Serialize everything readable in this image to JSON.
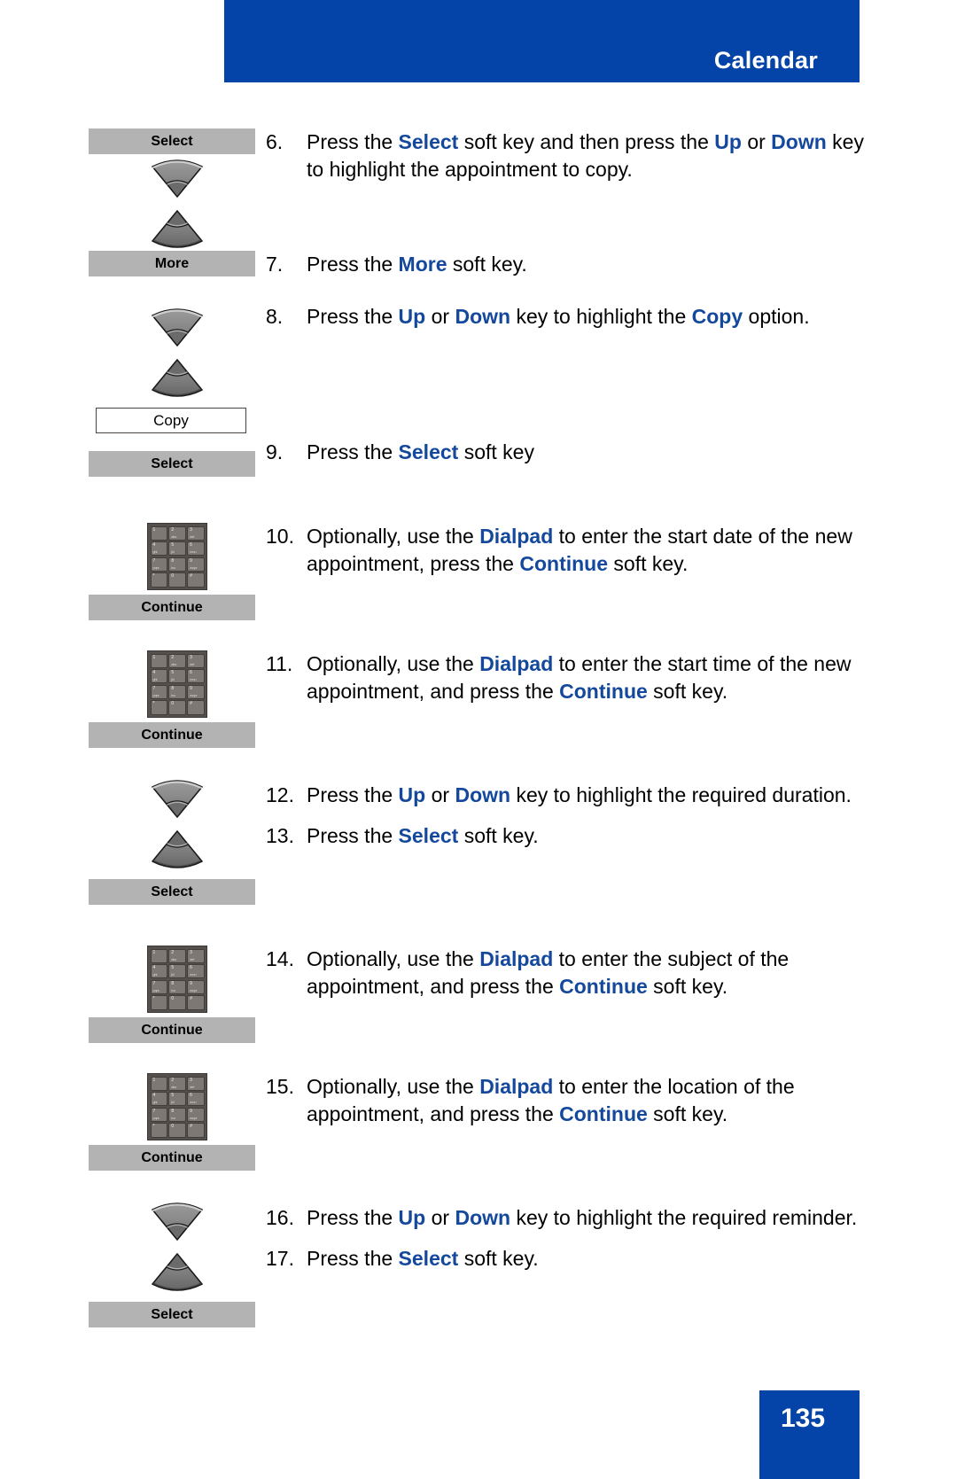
{
  "header": {
    "title": "Calendar",
    "bar_color": "#0443a7"
  },
  "footer": {
    "page_number": "135",
    "bar_color": "#0443a7"
  },
  "theme": {
    "keyword_color": "#13489c",
    "softkey_bg": "#b3b3b3",
    "menu_box_border": "#4a4440",
    "dialpad_body": "#56504c",
    "dialpad_key": "#7d7873"
  },
  "dialpad_keys": [
    {
      "digit": "1",
      "letters": ""
    },
    {
      "digit": "2",
      "letters": "abc"
    },
    {
      "digit": "3",
      "letters": "def"
    },
    {
      "digit": "4",
      "letters": "ghi"
    },
    {
      "digit": "5",
      "letters": "jkl"
    },
    {
      "digit": "6",
      "letters": "mno"
    },
    {
      "digit": "7",
      "letters": "pqrs"
    },
    {
      "digit": "8",
      "letters": "tuv"
    },
    {
      "digit": "9",
      "letters": "wxyz"
    },
    {
      "digit": "*",
      "letters": ""
    },
    {
      "digit": "0",
      "letters": ""
    },
    {
      "digit": "#",
      "letters": ""
    }
  ],
  "labels": {
    "select": "Select",
    "more": "More",
    "copy": "Copy",
    "continue": "Continue"
  },
  "steps": [
    {
      "num": "6.",
      "parts": [
        {
          "t": "Press the ",
          "b": false
        },
        {
          "t": "Select",
          "b": true
        },
        {
          "t": " soft key and then press the ",
          "b": false
        },
        {
          "t": "Up",
          "b": true
        },
        {
          "t": " or ",
          "b": false
        },
        {
          "t": "Down",
          "b": true
        },
        {
          "t": " key to highlight the appointment to copy.",
          "b": false
        }
      ]
    },
    {
      "num": "7.",
      "parts": [
        {
          "t": "Press the ",
          "b": false
        },
        {
          "t": "More",
          "b": true
        },
        {
          "t": " soft key.",
          "b": false
        }
      ]
    },
    {
      "num": "8.",
      "parts": [
        {
          "t": "Press the ",
          "b": false
        },
        {
          "t": "Up",
          "b": true
        },
        {
          "t": " or ",
          "b": false
        },
        {
          "t": "Down",
          "b": true
        },
        {
          "t": " key to highlight the ",
          "b": false
        },
        {
          "t": "Copy",
          "b": true
        },
        {
          "t": " option.",
          "b": false
        }
      ]
    },
    {
      "num": "9.",
      "parts": [
        {
          "t": "Press the ",
          "b": false
        },
        {
          "t": "Select",
          "b": true
        },
        {
          "t": " soft key",
          "b": false
        }
      ]
    },
    {
      "num": "10.",
      "parts": [
        {
          "t": "Optionally, use the ",
          "b": false
        },
        {
          "t": "Dialpad",
          "b": true
        },
        {
          "t": " to enter the start date of the new appointment, press the ",
          "b": false
        },
        {
          "t": "Continue",
          "b": true
        },
        {
          "t": " soft key.",
          "b": false
        }
      ]
    },
    {
      "num": "11.",
      "parts": [
        {
          "t": "Optionally, use the ",
          "b": false
        },
        {
          "t": "Dialpad",
          "b": true
        },
        {
          "t": " to enter the start time of the new appointment, and press the ",
          "b": false
        },
        {
          "t": "Continue",
          "b": true
        },
        {
          "t": " soft key.",
          "b": false
        }
      ]
    },
    {
      "num": "12.",
      "parts": [
        {
          "t": "Press the ",
          "b": false
        },
        {
          "t": "Up",
          "b": true
        },
        {
          "t": " or ",
          "b": false
        },
        {
          "t": "Down",
          "b": true
        },
        {
          "t": " key to highlight the required duration.",
          "b": false
        }
      ]
    },
    {
      "num": "13.",
      "parts": [
        {
          "t": "Press the ",
          "b": false
        },
        {
          "t": "Select",
          "b": true
        },
        {
          "t": " soft key.",
          "b": false
        }
      ]
    },
    {
      "num": "14.",
      "parts": [
        {
          "t": "Optionally, use the ",
          "b": false
        },
        {
          "t": "Dialpad",
          "b": true
        },
        {
          "t": " to enter the subject of the appointment, and press the ",
          "b": false
        },
        {
          "t": "Continue",
          "b": true
        },
        {
          "t": " soft key.",
          "b": false
        }
      ]
    },
    {
      "num": "15.",
      "parts": [
        {
          "t": "Optionally, use the ",
          "b": false
        },
        {
          "t": "Dialpad",
          "b": true
        },
        {
          "t": " to enter the location of the appointment, and press the ",
          "b": false
        },
        {
          "t": "Continue",
          "b": true
        },
        {
          "t": " soft key.",
          "b": false
        }
      ]
    },
    {
      "num": "16.",
      "parts": [
        {
          "t": "Press the ",
          "b": false
        },
        {
          "t": "Up",
          "b": true
        },
        {
          "t": " or ",
          "b": false
        },
        {
          "t": "Down",
          "b": true
        },
        {
          "t": " key to highlight the required reminder.",
          "b": false
        }
      ]
    },
    {
      "num": "17.",
      "parts": [
        {
          "t": "Press the ",
          "b": false
        },
        {
          "t": "Select",
          "b": true
        },
        {
          "t": " soft key.",
          "b": false
        }
      ]
    }
  ]
}
